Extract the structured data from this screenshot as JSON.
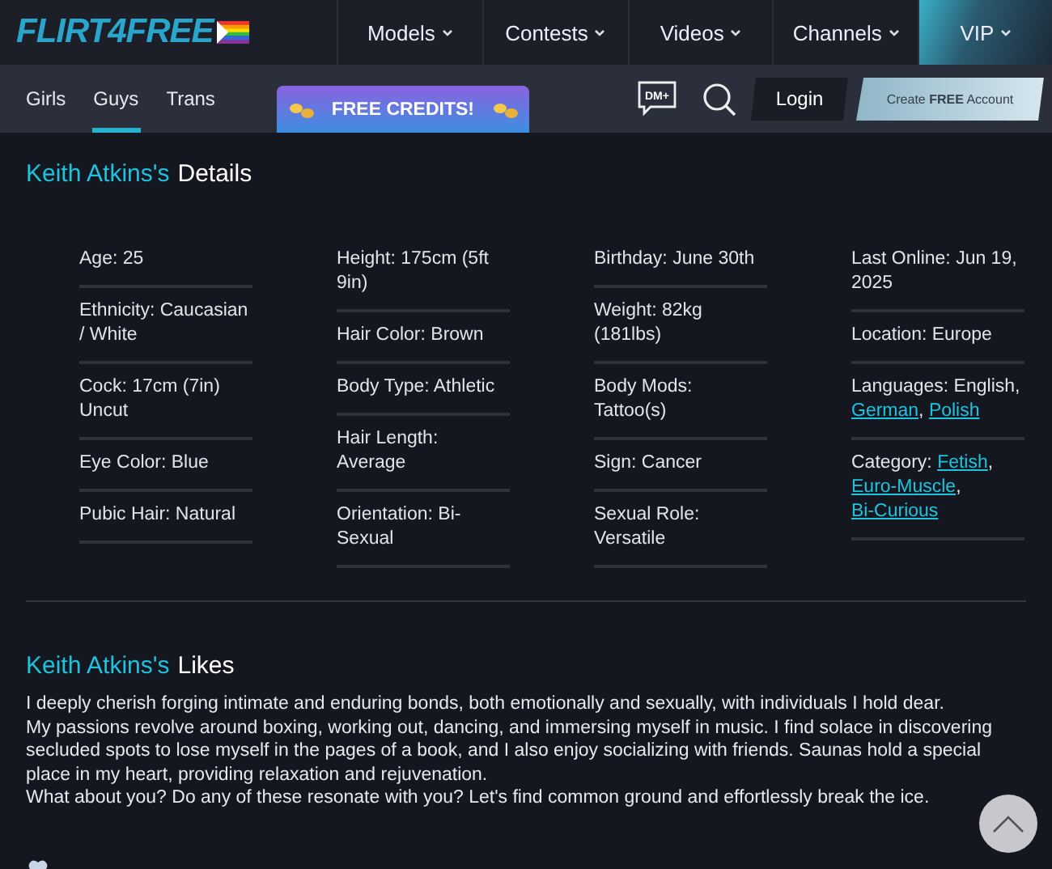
{
  "header": {
    "logo": "FLIRT4FREE",
    "nav": [
      {
        "label": "Models",
        "kind": "menu"
      },
      {
        "label": "Contests",
        "kind": "menu"
      },
      {
        "label": "Videos",
        "kind": "menu"
      },
      {
        "label": "Channels",
        "kind": "menu"
      },
      {
        "label": "VIP",
        "kind": "vip"
      }
    ]
  },
  "subnav": {
    "tabs": [
      {
        "label": "Girls",
        "selected": false
      },
      {
        "label": "Guys",
        "selected": true
      },
      {
        "label": "Trans",
        "selected": false
      }
    ],
    "promo": "FREE CREDITS!",
    "dm_badge": "DM+",
    "login": "Login",
    "signup": "Create **FREE** Account"
  },
  "details": {
    "name": "Keith Atkins's",
    "title": "Details",
    "columns": [
      [
        {
          "parts": [
            {
              "text": "Age: 25"
            }
          ]
        },
        {
          "parts": [
            {
              "text": "Ethnicity: Caucasian / White"
            }
          ]
        },
        {
          "parts": [
            {
              "text": "Cock: 17cm (7in) Uncut"
            }
          ]
        },
        {
          "parts": [
            {
              "text": "Eye Color: Blue"
            }
          ]
        },
        {
          "parts": [
            {
              "text": "Pubic Hair: Natural"
            }
          ]
        }
      ],
      [
        {
          "parts": [
            {
              "text": "Height: 175cm (5ft 9in)"
            }
          ]
        },
        {
          "parts": [
            {
              "text": "Hair Color: Brown"
            }
          ]
        },
        {
          "parts": [
            {
              "text": "Body Type: Athletic"
            }
          ]
        },
        {
          "parts": [
            {
              "text": "Hair Length: Average"
            }
          ]
        },
        {
          "parts": [
            {
              "text": "Orientation: Bi-Sexual"
            }
          ]
        }
      ],
      [
        {
          "parts": [
            {
              "text": "Birthday: June 30th"
            }
          ]
        },
        {
          "parts": [
            {
              "text": "Weight: 82kg (181lbs)"
            }
          ]
        },
        {
          "parts": [
            {
              "text": "Body Mods: Tattoo(s)"
            }
          ]
        },
        {
          "parts": [
            {
              "text": "Sign: Cancer"
            }
          ]
        },
        {
          "parts": [
            {
              "text": "Sexual Role: Versatile"
            }
          ]
        }
      ],
      [
        {
          "parts": [
            {
              "text": "Last Online: Jun 19, 2025"
            }
          ]
        },
        {
          "parts": [
            {
              "text": "Location: Europe"
            }
          ]
        },
        {
          "parts": [
            {
              "text": "Languages: English, "
            },
            {
              "text": "German",
              "kind": "link"
            },
            {
              "text": ", "
            },
            {
              "text": "Polish",
              "kind": "link"
            }
          ]
        },
        {
          "parts": [
            {
              "text": "Category: "
            },
            {
              "text": "Fetish",
              "kind": "link"
            },
            {
              "text": ", "
            },
            {
              "text": "Euro-Muscle",
              "kind": "link"
            },
            {
              "text": ", "
            },
            {
              "text": "Bi-Curious",
              "kind": "link"
            }
          ]
        }
      ]
    ]
  },
  "likes": {
    "name": "Keith Atkins's",
    "title": "Likes",
    "paragraphs": [
      "I deeply cherish forging intimate and enduring bonds, both emotionally and sexually, with individuals I hold dear.",
      "My passions revolve around boxing, working out, dancing, and immersing myself in music. I find solace in discovering secluded spots to lose myself in the pages of a book, and I also enjoy socializing with friends. Saunas hold a special place in my heart, providing relaxation and rejuvenation.",
      "What about you? Do any of these resonate with you? Let's find common ground and effortlessly break the ice."
    ]
  }
}
